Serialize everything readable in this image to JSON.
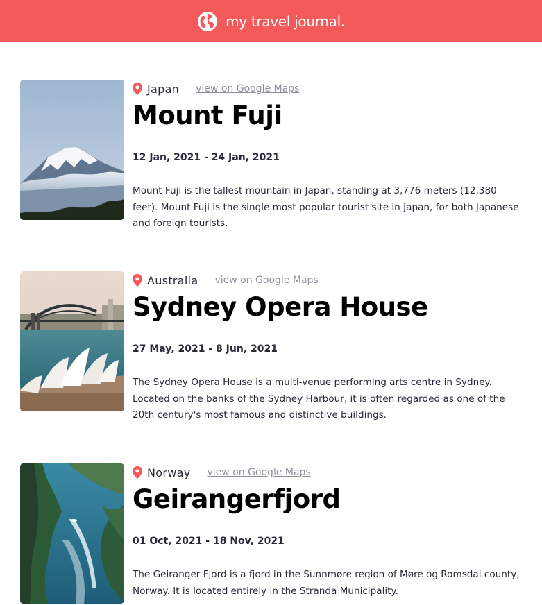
{
  "header": {
    "title": "my travel journal.",
    "icon": "globe-icon",
    "background": "#f55a5a"
  },
  "entries": [
    {
      "country": "Japan",
      "maps_link": "view on Google Maps",
      "title": "Mount Fuji",
      "dates": "12 Jan, 2021 - 24 Jan, 2021",
      "description": "Mount Fuji is the tallest mountain in Japan, standing at 3,776 meters (12,380 feet). Mount Fuji is the single most popular tourist site in Japan, for both Japanese and foreign tourists."
    },
    {
      "country": "Australia",
      "maps_link": "view on Google Maps",
      "title": "Sydney Opera House",
      "dates": "27 May, 2021 - 8 Jun, 2021",
      "description": "The Sydney Opera House is a multi-venue performing arts centre in Sydney. Located on the banks of the Sydney Harbour, it is often regarded as one of the 20th century's most famous and distinctive buildings."
    },
    {
      "country": "Norway",
      "maps_link": "view on Google Maps",
      "title": "Geirangerfjord",
      "dates": "01 Oct, 2021 - 18 Nov, 2021",
      "description": "The Geiranger Fjord is a fjord in the Sunnmøre region of Møre og Romsdal county, Norway. It is located entirely in the Stranda Municipality."
    }
  ],
  "icons": {
    "location": "location-pin-icon"
  },
  "colors": {
    "accent": "#f55a5a",
    "link": "#918e9b",
    "text": "#2b283a"
  }
}
